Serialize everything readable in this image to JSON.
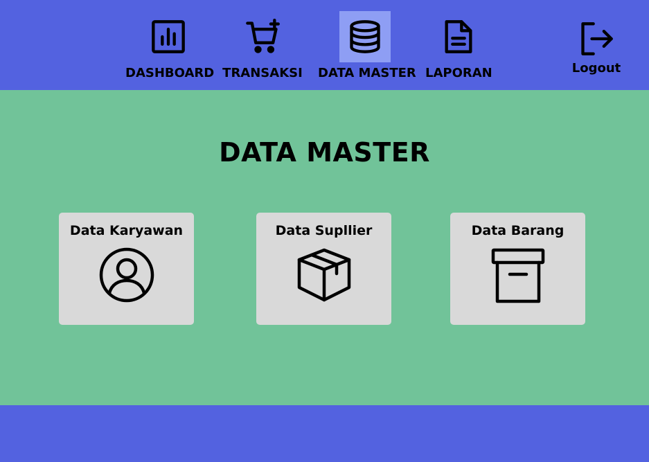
{
  "nav": {
    "items": [
      {
        "label": "DASHBOARD",
        "icon": "bar-chart-icon"
      },
      {
        "label": "TRANSAKSI",
        "icon": "cart-plus-icon"
      },
      {
        "label": "DATA MASTER",
        "icon": "database-icon",
        "active": true
      },
      {
        "label": "LAPORAN",
        "icon": "document-icon"
      }
    ],
    "logout": {
      "label": "Logout",
      "icon": "logout-icon"
    }
  },
  "main": {
    "title": "DATA MASTER",
    "cards": [
      {
        "label": "Data Karyawan",
        "icon": "user-icon"
      },
      {
        "label": "Data Supllier",
        "icon": "box-icon"
      },
      {
        "label": "Data Barang",
        "icon": "archive-icon"
      }
    ]
  },
  "colors": {
    "header": "#5362E0",
    "active_nav": "#8E9EF4",
    "main_bg": "#71C399",
    "card_bg": "#D9D9D9",
    "footer": "#5362E0"
  }
}
